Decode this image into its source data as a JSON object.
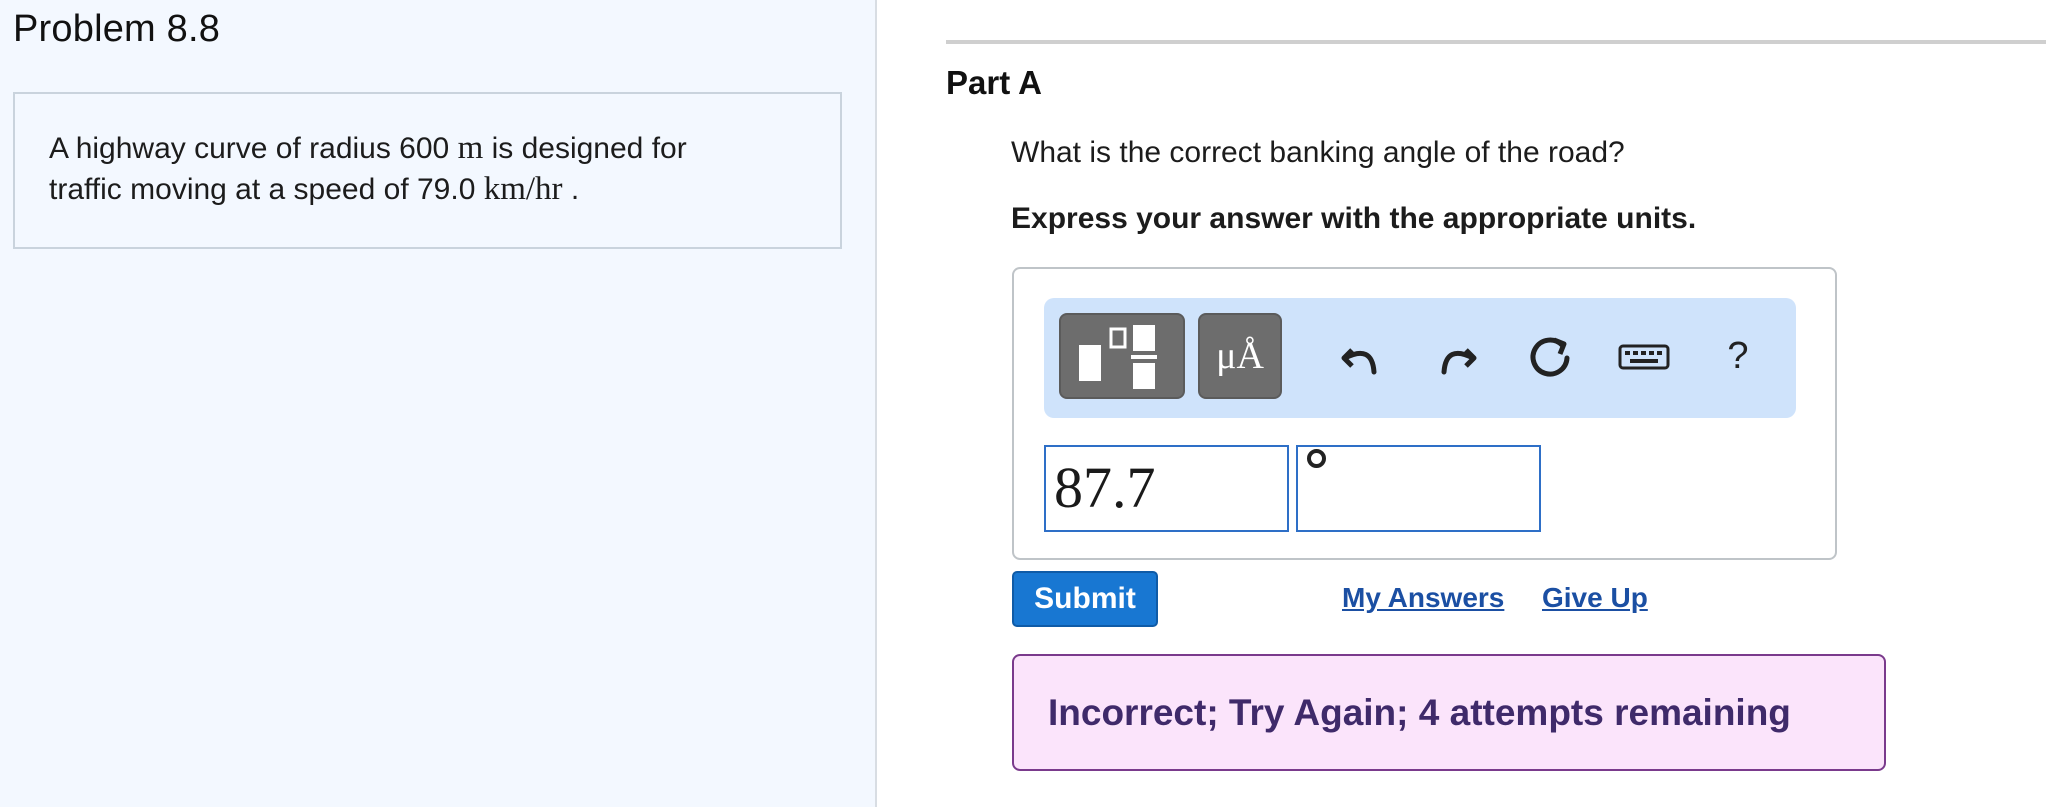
{
  "problem": {
    "title": "Problem 8.8",
    "text_part1": "A highway curve of radius 600 ",
    "unit_m": "m",
    "text_part2": " is designed for",
    "text_line2_part1": "traffic moving at a speed of 79.0 ",
    "unit_speed": "km/hr",
    "text_line2_part2": " ."
  },
  "part": {
    "title": "Part A",
    "question": "What is the correct banking angle of the road?",
    "instruction": "Express your answer with the appropriate units."
  },
  "toolbar": {
    "units_label": "μÅ",
    "undo_icon": "undo-icon",
    "redo_icon": "redo-icon",
    "reset_icon": "reset-icon",
    "keyboard_icon": "keyboard-icon",
    "help_label": "?"
  },
  "answer": {
    "value": "87.7",
    "unit_symbol": "°"
  },
  "actions": {
    "submit_label": "Submit",
    "my_answers_label": "My Answers",
    "give_up_label": "Give Up"
  },
  "feedback": {
    "message": "Incorrect; Try Again; 4 attempts remaining"
  },
  "colors": {
    "accent": "#1877d2",
    "panel_bg": "#f3f8ff",
    "toolbar_bg": "#cfe3fb",
    "feedback_bg": "#fbe4fb",
    "feedback_border": "#7a3a8c"
  }
}
